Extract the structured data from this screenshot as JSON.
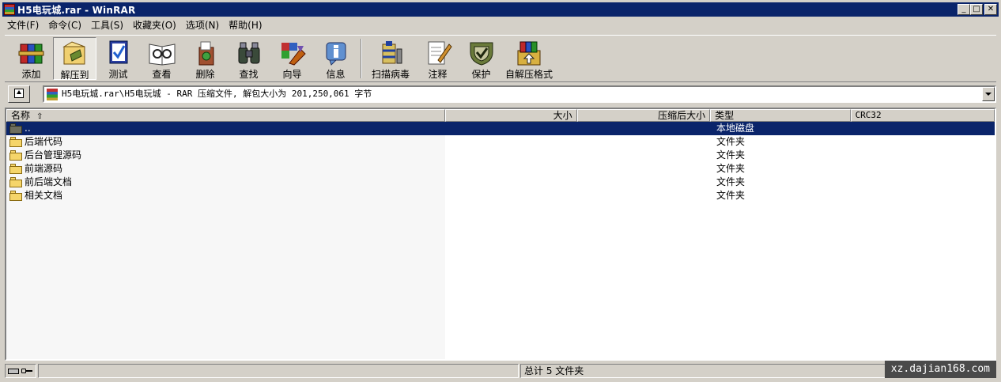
{
  "window": {
    "title": "H5电玩城.rar - WinRAR",
    "minimize_label": "_",
    "maximize_label": "□",
    "close_label": "✕"
  },
  "menu": [
    {
      "label": "文件(F)"
    },
    {
      "label": "命令(C)"
    },
    {
      "label": "工具(S)"
    },
    {
      "label": "收藏夹(O)"
    },
    {
      "label": "选项(N)"
    },
    {
      "label": "帮助(H)"
    }
  ],
  "toolbar": [
    {
      "label": "添加",
      "icon": "add-archive-icon"
    },
    {
      "label": "解压到",
      "icon": "extract-to-icon",
      "pressed": true
    },
    {
      "label": "测试",
      "icon": "test-icon"
    },
    {
      "label": "查看",
      "icon": "view-icon"
    },
    {
      "label": "删除",
      "icon": "delete-icon"
    },
    {
      "label": "查找",
      "icon": "find-icon"
    },
    {
      "label": "向导",
      "icon": "wizard-icon"
    },
    {
      "label": "信息",
      "icon": "info-icon"
    },
    {
      "label": "扫描病毒",
      "icon": "virus-scan-icon"
    },
    {
      "label": "注释",
      "icon": "comment-icon"
    },
    {
      "label": "保护",
      "icon": "protect-icon"
    },
    {
      "label": "自解压格式",
      "icon": "sfx-icon"
    }
  ],
  "address": {
    "path": "H5电玩城.rar\\H5电玩城 - RAR 压缩文件, 解包大小为 201,250,061 字节"
  },
  "columns": {
    "name": "名称",
    "size": "大小",
    "packed": "压缩后大小",
    "type": "类型",
    "crc": "CRC32"
  },
  "rows": [
    {
      "name": "..",
      "type": "本地磁盘",
      "selected": true
    },
    {
      "name": "后端代码",
      "type": "文件夹"
    },
    {
      "name": "后台管理源码",
      "type": "文件夹"
    },
    {
      "name": "前端源码",
      "type": "文件夹"
    },
    {
      "name": "前后端文档",
      "type": "文件夹"
    },
    {
      "name": "相关文档",
      "type": "文件夹"
    }
  ],
  "status": {
    "total": "总计 5 文件夹"
  },
  "watermark": "xz.dajian168.com",
  "colors": {
    "titlebar": "#0a246a",
    "face": "#d4d0c8",
    "selection": "#0a246a"
  }
}
